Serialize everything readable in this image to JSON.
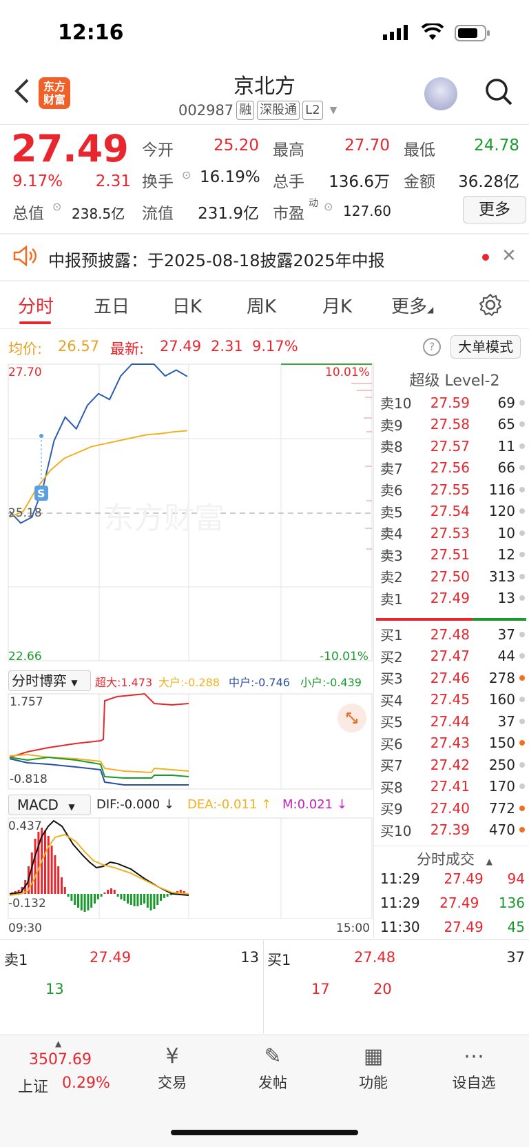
{
  "status_bar": {
    "time": "12:16"
  },
  "header": {
    "logo_text": "东方财富",
    "title": "京北方",
    "code": "002987",
    "tags": [
      "融",
      "深股通",
      "L2"
    ]
  },
  "quote": {
    "price": "27.49",
    "change_pct": "9.17%",
    "change": "2.31",
    "open_label": "今开",
    "open": "25.20",
    "high_label": "最高",
    "high": "27.70",
    "low_label": "最低",
    "low": "24.78",
    "turnover_label": "换手",
    "turnover": "16.19%",
    "volume_label": "总手",
    "volume": "136.6万",
    "amount_label": "金额",
    "amount": "36.28亿",
    "mktcap_label": "总值",
    "mktcap": "238.5亿",
    "float_label": "流值",
    "float": "231.9亿",
    "pe_label": "市盈",
    "pe_sup": "动",
    "pe": "127.60",
    "more": "更多"
  },
  "notice": {
    "text": "中报预披露：于2025-08-18披露2025年中报"
  },
  "tabs": [
    "分时",
    "五日",
    "日K",
    "周K",
    "月K",
    "更多"
  ],
  "info": {
    "avg_label": "均价:",
    "avg": "26.57",
    "latest_label": "最新:",
    "latest": "27.49",
    "change": "2.31",
    "pct": "9.17%",
    "mode": "大单模式"
  },
  "chart_data": {
    "type": "line",
    "y_top": "27.70",
    "y_mid": "25.18",
    "y_bottom": "22.66",
    "pct_top": "10.01%",
    "pct_bottom": "-10.01%",
    "x_start": "09:30",
    "x_end": "15:00",
    "watermark": "东方财富",
    "series": [
      {
        "values": [
          25.2,
          25.0,
          25.1,
          25.6,
          26.4,
          26.8,
          26.6,
          27.0,
          27.2,
          27.1,
          27.5,
          27.7,
          27.7,
          27.7,
          27.5,
          27.6,
          27.49
        ]
      },
      {
        "values": [
          25.1,
          25.2,
          25.6,
          25.9,
          26.1,
          26.2,
          26.3,
          26.35,
          26.4,
          26.45,
          26.5,
          26.52,
          26.55,
          26.57
        ]
      }
    ]
  },
  "game": {
    "label": "分时博弈",
    "super": "超大:1.473",
    "big": "大户:-0.288",
    "mid": "中户:-0.746",
    "small": "小户:-0.439",
    "y_top": "1.757",
    "y_bottom": "-0.818"
  },
  "macd": {
    "label": "MACD",
    "dif": "DIF:-0.000 ↓",
    "dea": "DEA:-0.011 ↑",
    "m": "M:0.021 ↓",
    "y_top": "0.437",
    "y_bottom": "-0.132"
  },
  "orderbook": {
    "title": "超级 Level-2",
    "asks": [
      {
        "label": "卖10",
        "price": "27.59",
        "vol": "69",
        "dot": "g"
      },
      {
        "label": "卖9",
        "price": "27.58",
        "vol": "65",
        "dot": "g"
      },
      {
        "label": "卖8",
        "price": "27.57",
        "vol": "11",
        "dot": "g"
      },
      {
        "label": "卖7",
        "price": "27.56",
        "vol": "66",
        "dot": "g"
      },
      {
        "label": "卖6",
        "price": "27.55",
        "vol": "116",
        "dot": "g"
      },
      {
        "label": "卖5",
        "price": "27.54",
        "vol": "120",
        "dot": "g"
      },
      {
        "label": "卖4",
        "price": "27.53",
        "vol": "10",
        "dot": "g"
      },
      {
        "label": "卖3",
        "price": "27.51",
        "vol": "12",
        "dot": "g"
      },
      {
        "label": "卖2",
        "price": "27.50",
        "vol": "313",
        "dot": "g"
      },
      {
        "label": "卖1",
        "price": "27.49",
        "vol": "13",
        "dot": "g"
      }
    ],
    "bids": [
      {
        "label": "买1",
        "price": "27.48",
        "vol": "37",
        "dot": "g"
      },
      {
        "label": "买2",
        "price": "27.47",
        "vol": "44",
        "dot": "g"
      },
      {
        "label": "买3",
        "price": "27.46",
        "vol": "278",
        "dot": "o"
      },
      {
        "label": "买4",
        "price": "27.45",
        "vol": "160",
        "dot": "g"
      },
      {
        "label": "买5",
        "price": "27.44",
        "vol": "37",
        "dot": "g"
      },
      {
        "label": "买6",
        "price": "27.43",
        "vol": "150",
        "dot": "o"
      },
      {
        "label": "买7",
        "price": "27.42",
        "vol": "250",
        "dot": "g"
      },
      {
        "label": "买8",
        "price": "27.41",
        "vol": "170",
        "dot": "g"
      },
      {
        "label": "买9",
        "price": "27.40",
        "vol": "772",
        "dot": "o"
      },
      {
        "label": "买10",
        "price": "27.39",
        "vol": "470",
        "dot": "o"
      }
    ],
    "trades_title": "分时成交",
    "trades": [
      {
        "time": "11:29",
        "price": "27.49",
        "vol": "94"
      },
      {
        "time": "11:29",
        "price": "27.49",
        "vol": "136"
      },
      {
        "time": "11:30",
        "price": "27.49",
        "vol": "45"
      }
    ]
  },
  "queue": {
    "sell_label": "卖1",
    "sell_price": "27.49",
    "sell_vol": "13",
    "buy_label": "买1",
    "buy_price": "27.48",
    "buy_vol": "37",
    "sell_orders": [
      "13"
    ],
    "buy_orders": [
      "17",
      "20"
    ]
  },
  "bottom_nav": {
    "index_value": "3507.69",
    "index_name": "上证",
    "index_pct": "0.29%",
    "items": [
      "交易",
      "发帖",
      "功能",
      "设自选"
    ]
  }
}
